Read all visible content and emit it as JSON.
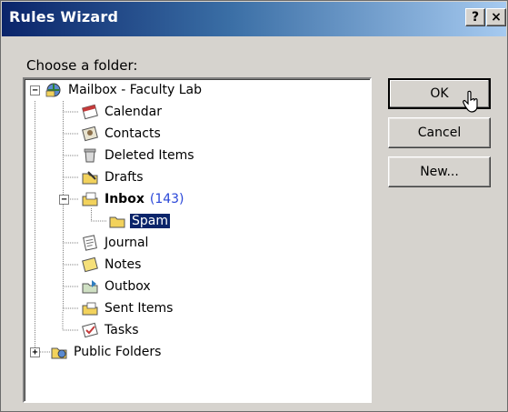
{
  "window": {
    "title": "Rules Wizard",
    "help_button": "?",
    "close_button": "×"
  },
  "prompt": "Choose a folder:",
  "tree": {
    "root": {
      "label": "Mailbox - Faculty Lab",
      "icon": "mailbox-icon"
    },
    "items": [
      {
        "label": "Calendar",
        "icon": "calendar-icon"
      },
      {
        "label": "Contacts",
        "icon": "contacts-icon"
      },
      {
        "label": "Deleted Items",
        "icon": "deleted-items-icon"
      },
      {
        "label": "Drafts",
        "icon": "drafts-icon"
      },
      {
        "label": "Inbox",
        "count": "(143)",
        "icon": "inbox-icon"
      },
      {
        "label": "Spam",
        "icon": "folder-icon",
        "selected": true
      },
      {
        "label": "Journal",
        "icon": "journal-icon"
      },
      {
        "label": "Notes",
        "icon": "notes-icon"
      },
      {
        "label": "Outbox",
        "icon": "outbox-icon"
      },
      {
        "label": "Sent Items",
        "icon": "sent-items-icon"
      },
      {
        "label": "Tasks",
        "icon": "tasks-icon"
      }
    ],
    "public": {
      "label": "Public Folders",
      "icon": "public-folders-icon"
    }
  },
  "buttons": {
    "ok": "OK",
    "cancel": "Cancel",
    "new": "New..."
  },
  "colors": {
    "selection": "#0a246a",
    "count": "#2a47d8",
    "titlebar_start": "#0a246a",
    "face": "#d6d3ce"
  }
}
